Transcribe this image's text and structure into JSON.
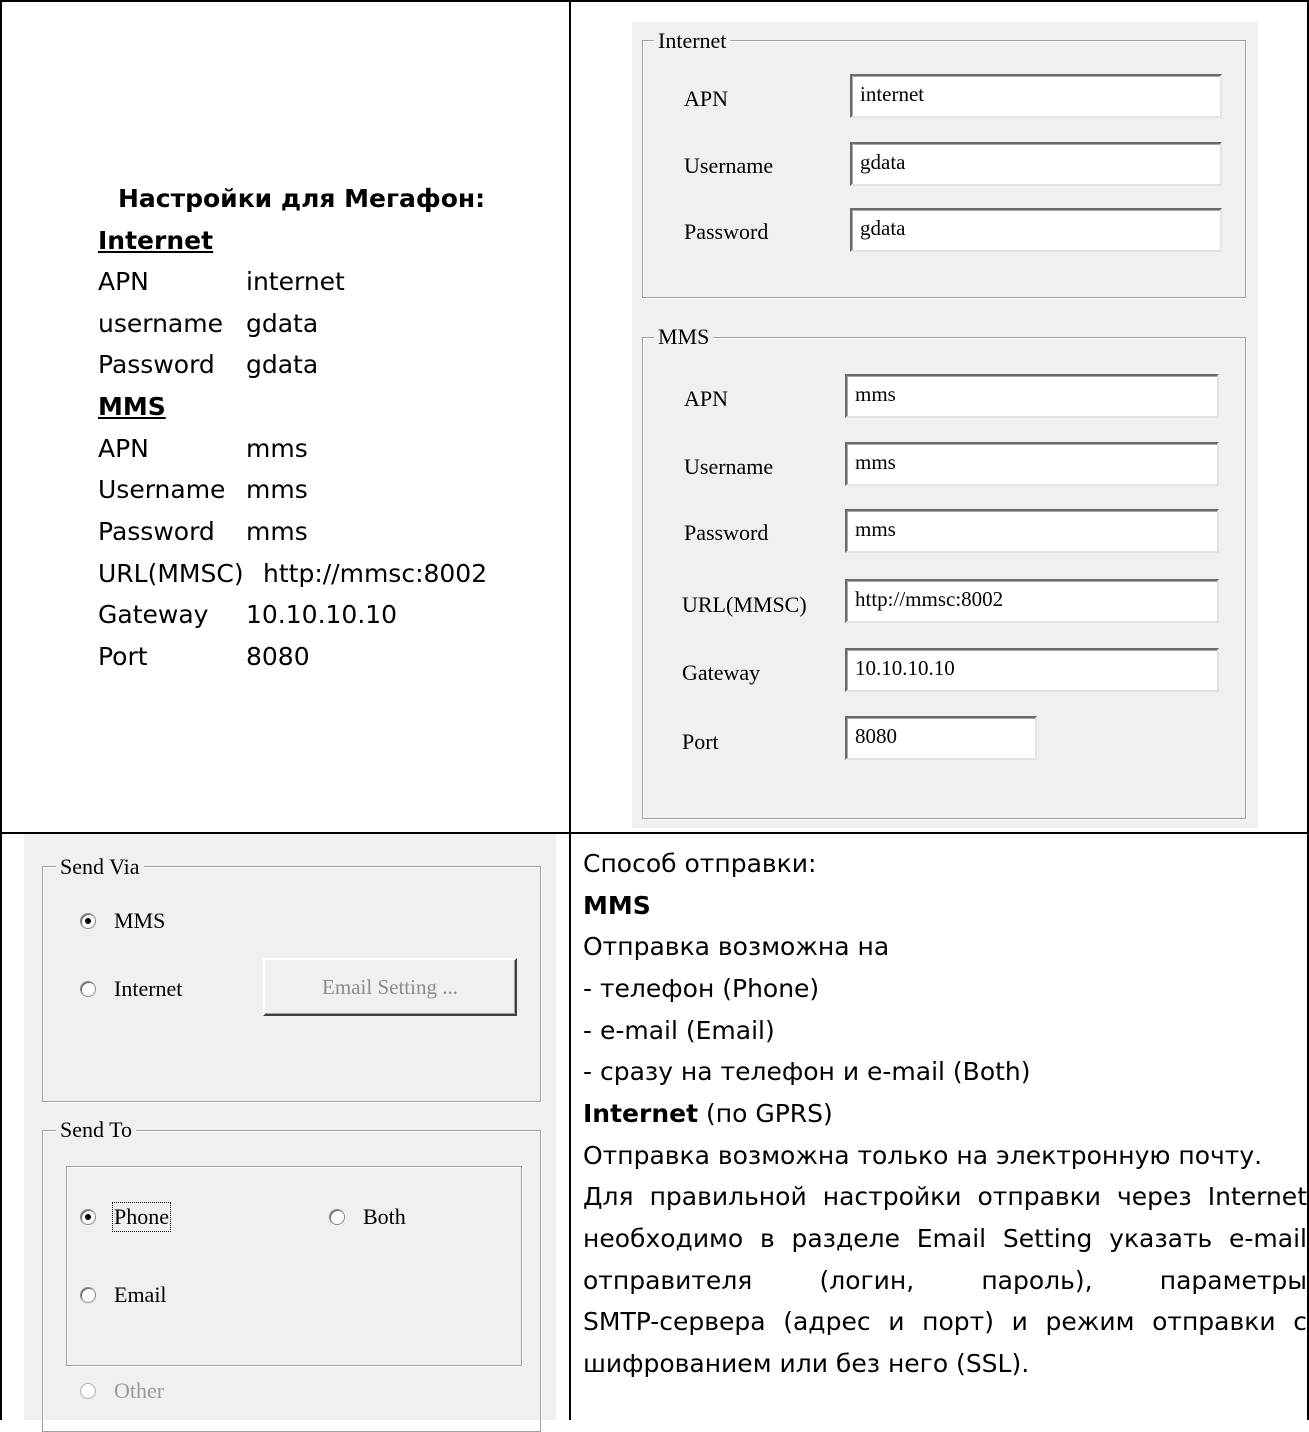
{
  "top_left": {
    "heading": "Настройки для Мегафон:",
    "internet_header": "Internet",
    "internet_rows": [
      {
        "label": "APN",
        "value": "internet"
      },
      {
        "label": "username",
        "value": "gdata"
      },
      {
        "label": "Password",
        "value": "gdata"
      }
    ],
    "mms_header": "MMS",
    "mms_rows": [
      {
        "label": "APN",
        "value": "mms"
      },
      {
        "label": "Username",
        "value": "mms"
      },
      {
        "label": "Password",
        "value": "mms"
      },
      {
        "label": "URL(MMSC)",
        "value": "http://mmsc:8002"
      },
      {
        "label": "Gateway",
        "value": "10.10.10.10"
      },
      {
        "label": "Port",
        "value": "8080"
      }
    ]
  },
  "settings_dialog": {
    "internet_group": {
      "title": "Internet",
      "fields": [
        {
          "label": "APN",
          "value": "internet"
        },
        {
          "label": "Username",
          "value": "gdata"
        },
        {
          "label": "Password",
          "value": "gdata"
        }
      ]
    },
    "mms_group": {
      "title": "MMS",
      "fields": [
        {
          "label": "APN",
          "value": "mms"
        },
        {
          "label": "Username",
          "value": "mms"
        },
        {
          "label": "Password",
          "value": "mms"
        },
        {
          "label": "URL(MMSC)",
          "value": "http://mmsc:8002"
        },
        {
          "label": "Gateway",
          "value": "10.10.10.10"
        },
        {
          "label": "Port",
          "value": "8080"
        }
      ]
    }
  },
  "send_dialog": {
    "send_via": {
      "title": "Send Via",
      "mms_label": "MMS",
      "internet_label": "Internet",
      "email_setting_button": "Email Setting ...",
      "selected": "MMS"
    },
    "send_to": {
      "title": "Send To",
      "phone_label": "Phone",
      "both_label": "Both",
      "email_label": "Email",
      "other_label": "Other",
      "selected": "Phone"
    }
  },
  "bottom_right": {
    "line1": "Способ отправки:",
    "mms_heading": "MMS",
    "line3": "Отправка возможна на",
    "line4": "- телефон (Phone)",
    "line5": "- e-mail (Email)",
    "line6": "- сразу на телефон и e-mail (Both)",
    "internet_heading": "Internet",
    "internet_suffix": " (по GPRS)",
    "line8": "Отправка возможна только на электронную почту.",
    "line9": "Для правильной настройки отправки через Internet",
    "line10": "необходимо в разделе Email Setting указать e-mail",
    "line11": "отправителя (логин, пароль), параметры",
    "line12": "SMTP-сервера (адрес и порт) и режим отправки с",
    "line13": "шифрованием или без него (SSL)."
  }
}
